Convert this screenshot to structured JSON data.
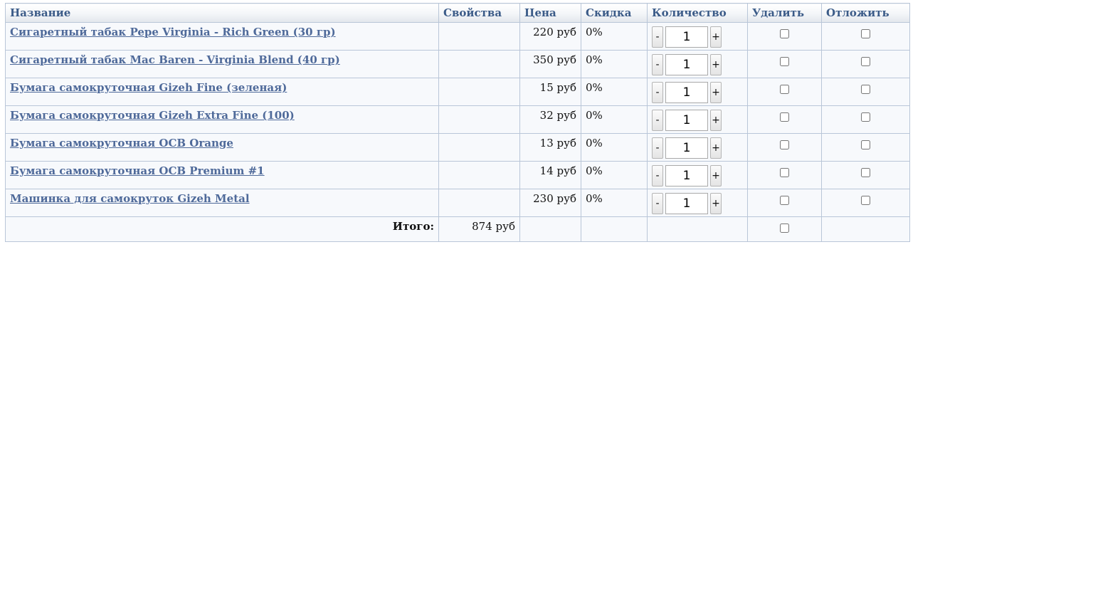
{
  "table": {
    "headers": {
      "name": "Название",
      "props": "Свойства",
      "price": "Цена",
      "discount": "Скидка",
      "quantity": "Количество",
      "delete": "Удалить",
      "delay": "Отложить"
    },
    "rows": [
      {
        "name": "Сигаретный табак Pepe Virginia - Rich Green (30 гр)",
        "props": "",
        "price": "220 руб",
        "discount": "0%",
        "qty": "1"
      },
      {
        "name": "Сигаретный табак Mac Baren - Virginia Blend (40 гр)",
        "props": "",
        "price": "350 руб",
        "discount": "0%",
        "qty": "1"
      },
      {
        "name": "Бумага самокруточная Gizeh Fine (зеленая)",
        "props": "",
        "price": "15 руб",
        "discount": "0%",
        "qty": "1"
      },
      {
        "name": "Бумага самокруточная Gizeh Extra Fine (100)",
        "props": "",
        "price": "32 руб",
        "discount": "0%",
        "qty": "1"
      },
      {
        "name": "Бумага самокруточная OCB Orange",
        "props": "",
        "price": "13 руб",
        "discount": "0%",
        "qty": "1"
      },
      {
        "name": "Бумага самокруточная OCB Premium #1",
        "props": "",
        "price": "14 руб",
        "discount": "0%",
        "qty": "1"
      },
      {
        "name": "Машинка для самокруток Gizeh Metal",
        "props": "",
        "price": "230 руб",
        "discount": "0%",
        "qty": "1"
      }
    ],
    "qty_minus": "-",
    "qty_plus": "+",
    "total": {
      "label": "Итого:",
      "value": "874 руб"
    }
  },
  "colors": {
    "header_text": "#3b5b88",
    "link": "#4f6a9a",
    "border": "#b9c6d8",
    "row_bg": "#f7f9fc"
  }
}
